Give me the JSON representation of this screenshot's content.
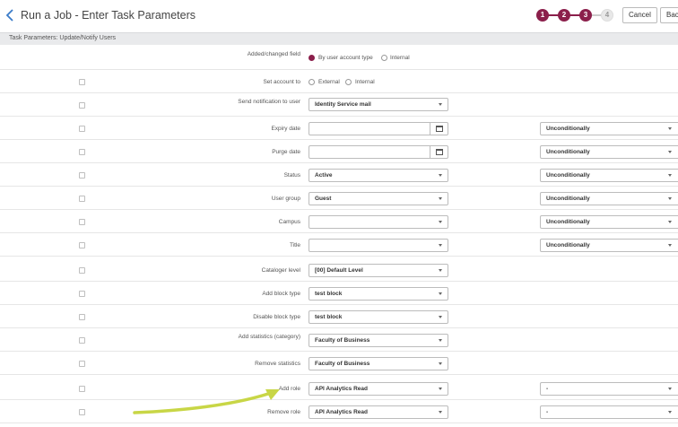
{
  "header": {
    "title": "Run a Job - Enter Task Parameters",
    "steps": [
      "1",
      "2",
      "3",
      "4"
    ],
    "cancel_label": "Cancel",
    "back_label": "Back"
  },
  "section": {
    "title": "Task Parameters: Update/Notify Users"
  },
  "rows": [
    {
      "label": "Added/changed field",
      "radios": [
        "By user account type",
        "Internal"
      ],
      "selected": "By user account type"
    },
    {
      "label": "Set account to",
      "radios": [
        "External",
        "Internal"
      ],
      "selected": ""
    },
    {
      "label": "Send notification to user",
      "value": "Identity Service mail"
    },
    {
      "label": "Expiry date",
      "value": "",
      "condition": "Unconditionally"
    },
    {
      "label": "Purge date",
      "value": "",
      "condition": "Unconditionally"
    },
    {
      "label": "Status",
      "value": "Active",
      "condition": "Unconditionally"
    },
    {
      "label": "User group",
      "value": "Guest",
      "condition": "Unconditionally"
    },
    {
      "label": "Campus",
      "value": "",
      "condition": "Unconditionally"
    },
    {
      "label": "Title",
      "value": "",
      "condition": "Unconditionally"
    },
    {
      "label": "Cataloger level",
      "value": "[00] Default Level"
    },
    {
      "label": "Add block type",
      "value": "test block"
    },
    {
      "label": "Disable block type",
      "value": "test block"
    },
    {
      "label": "Add statistics (category)",
      "value": "Faculty of Business"
    },
    {
      "label": "Remove statistics",
      "value": "Faculty of Business"
    },
    {
      "label": "Add role",
      "value": "API Analytics Read",
      "condition": "-"
    },
    {
      "label": "Remove role",
      "value": "API Analytics Read",
      "condition": "-"
    }
  ],
  "colors": {
    "accent": "#8b1f4b",
    "annotation_arrow": "#c8d646"
  }
}
